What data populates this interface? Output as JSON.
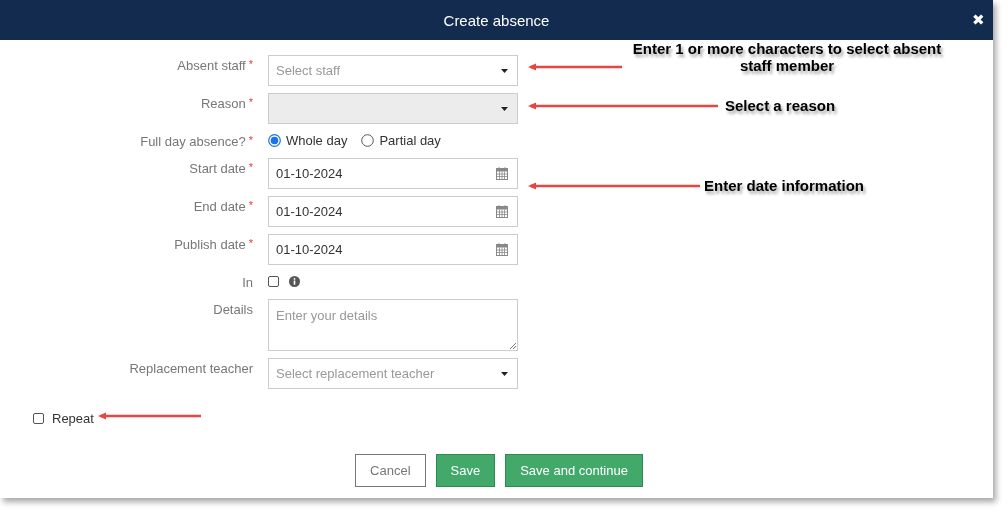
{
  "dialog": {
    "title": "Create absence",
    "close": "✖"
  },
  "fields": [
    {
      "kind": "select",
      "label": "Absent staff",
      "required_mark": "*",
      "placeholder": "Select staff",
      "disabled": false
    },
    {
      "kind": "select",
      "label": "Reason",
      "required_mark": "*",
      "disabled": true
    },
    {
      "kind": "radio",
      "label": "Full day absence?",
      "required_mark": "*",
      "options": [
        {
          "label": "Whole day",
          "selected": true
        },
        {
          "label": "Partial day",
          "selected": false
        }
      ]
    },
    {
      "kind": "date",
      "label": "Start date",
      "required_mark": "*",
      "value": "01-10-2024"
    },
    {
      "kind": "date",
      "label": "End date",
      "required_mark": "*",
      "value": "01-10-2024"
    },
    {
      "kind": "date",
      "label": "Publish date",
      "required_mark": "*",
      "value": "01-10-2024"
    },
    {
      "kind": "checkbox",
      "label": "In",
      "checked": false,
      "info": true
    },
    {
      "kind": "textarea",
      "label": "Details",
      "placeholder": "Enter your details"
    },
    {
      "kind": "select",
      "label": "Replacement teacher",
      "placeholder": "Select replacement teacher",
      "disabled": false
    }
  ],
  "repeat": {
    "label": "Repeat",
    "checked": false
  },
  "buttons": [
    {
      "label": "Cancel",
      "kind": "secondary"
    },
    {
      "label": "Save",
      "kind": "primary"
    },
    {
      "label": "Save and continue",
      "kind": "primary"
    }
  ],
  "annotations": [
    {
      "kind": "callout",
      "text": "Enter 1 or more characters to select absent staff member"
    },
    {
      "kind": "callout",
      "text": "Select a reason"
    },
    {
      "kind": "callout",
      "text": "Enter date information"
    },
    {
      "kind": "arrow"
    }
  ]
}
